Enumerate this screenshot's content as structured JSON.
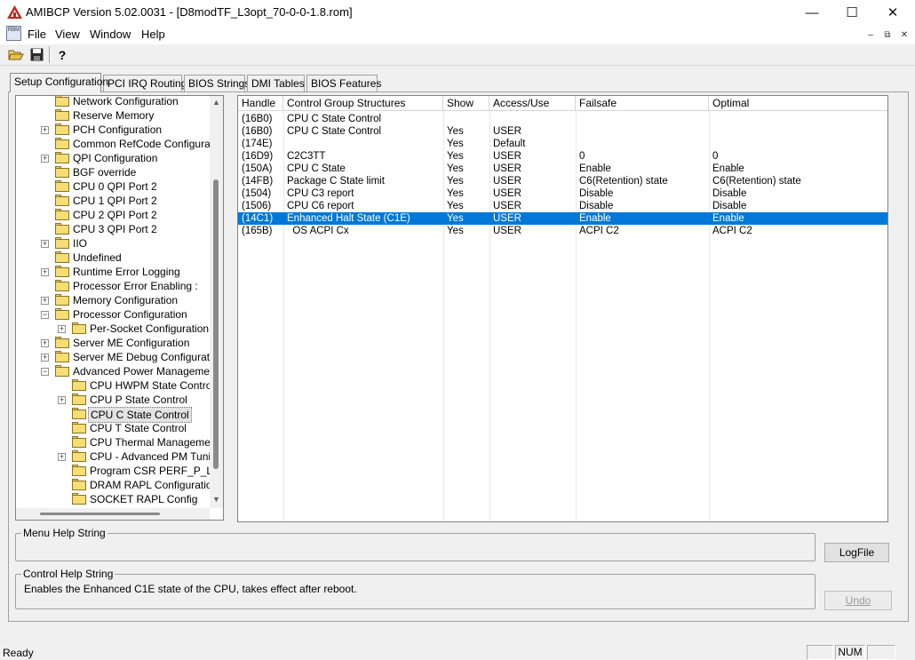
{
  "window": {
    "title": "AMIBCP Version 5.02.0031 - [D8modTF_L3opt_70-0-0-1.8.rom]",
    "minimize_glyph": "—",
    "maximize_glyph": "☐",
    "close_glyph": "✕"
  },
  "menu": {
    "icon_text": "RBM",
    "items": [
      "File",
      "View",
      "Window",
      "Help"
    ],
    "mdi_min": "–",
    "mdi_restore": "⧉",
    "mdi_close": "✕"
  },
  "toolbar": {
    "icons": [
      "open-folder-icon",
      "save-icon",
      "help-icon"
    ],
    "help_glyph": "?"
  },
  "tabs": [
    "Setup Configuration",
    "PCI IRQ Routing",
    "BIOS Strings",
    "DMI Tables",
    "BIOS Features"
  ],
  "tree": {
    "items": [
      {
        "label": "Network Configuration",
        "expander": ""
      },
      {
        "label": "Reserve Memory",
        "expander": ""
      },
      {
        "label": "PCH Configuration",
        "expander": "+"
      },
      {
        "label": "Common RefCode Configuration",
        "expander": ""
      },
      {
        "label": "QPI Configuration",
        "expander": "+"
      },
      {
        "label": "BGF override",
        "expander": ""
      },
      {
        "label": "CPU 0 QPI Port 2",
        "expander": ""
      },
      {
        "label": "CPU 1 QPI Port 2",
        "expander": ""
      },
      {
        "label": "CPU 2 QPI Port 2",
        "expander": ""
      },
      {
        "label": "CPU 3 QPI Port 2",
        "expander": ""
      },
      {
        "label": "IIO",
        "expander": "+"
      },
      {
        "label": "Undefined",
        "expander": ""
      },
      {
        "label": "Runtime Error Logging",
        "expander": "+"
      },
      {
        "label": "Processor Error Enabling :",
        "expander": ""
      },
      {
        "label": "Memory Configuration",
        "expander": "+"
      },
      {
        "label": "Processor Configuration",
        "expander": "−"
      },
      {
        "label": "Per-Socket Configuration",
        "expander": "+"
      },
      {
        "label": "Server ME Configuration",
        "expander": "+"
      },
      {
        "label": "Server ME Debug Configuration",
        "expander": "+"
      },
      {
        "label": "Advanced Power Management C",
        "expander": "−"
      },
      {
        "label": "CPU HWPM State Control",
        "expander": ""
      },
      {
        "label": "CPU P State Control",
        "expander": "+"
      },
      {
        "label": "CPU C State Control",
        "expander": ""
      },
      {
        "label": "CPU T State Control",
        "expander": ""
      },
      {
        "label": "CPU Thermal Management",
        "expander": ""
      },
      {
        "label": "CPU - Advanced PM Tuning",
        "expander": "+"
      },
      {
        "label": "Program CSR PERF_P_LIMI",
        "expander": ""
      },
      {
        "label": "DRAM RAPL Configuration",
        "expander": ""
      },
      {
        "label": "SOCKET RAPL Config",
        "expander": ""
      }
    ],
    "selected": "CPU C State Control",
    "scroll_up_glyph": "▲",
    "scroll_down_glyph": "▼"
  },
  "grid": {
    "columns": [
      "Handle",
      "Control Group Structures",
      "Show",
      "Access/Use",
      "Failsafe",
      "Optimal"
    ],
    "rows": [
      [
        "(16B0)",
        "CPU C State Control",
        "",
        "",
        "",
        ""
      ],
      [
        "(16B0)",
        "CPU C State Control",
        "Yes",
        "USER",
        "",
        ""
      ],
      [
        "(174E)",
        "",
        "Yes",
        "Default",
        "",
        ""
      ],
      [
        "(16D9)",
        "C2C3TT",
        "Yes",
        "USER",
        "0",
        "0"
      ],
      [
        "(150A)",
        "CPU C State",
        "Yes",
        "USER",
        "Enable",
        "Enable"
      ],
      [
        "(14FB)",
        "Package C State limit",
        "Yes",
        "USER",
        "C6(Retention) state",
        "C6(Retention) state"
      ],
      [
        "(1504)",
        "CPU C3 report",
        "Yes",
        "USER",
        "Disable",
        "Disable"
      ],
      [
        "(1506)",
        "CPU C6 report",
        "Yes",
        "USER",
        "Disable",
        "Disable"
      ],
      [
        "(14C1)",
        "Enhanced Halt State (C1E)",
        "Yes",
        "USER",
        "Enable",
        "Enable"
      ],
      [
        "(165B)",
        "  OS ACPI Cx",
        "Yes",
        "USER",
        "ACPI C2",
        "ACPI C2"
      ]
    ],
    "highlighted_row": 8
  },
  "help": {
    "menu_label": "Menu Help String",
    "menu_text": "",
    "control_label": "Control Help String",
    "control_text": "Enables the Enhanced C1E state of the CPU, takes effect after reboot.",
    "logfile_button": "LogFile",
    "undo_button": "Undo"
  },
  "status": {
    "text": "Ready",
    "num": "NUM"
  },
  "colors": {
    "selection": "#0078d7",
    "folder": "#f6dd74"
  }
}
